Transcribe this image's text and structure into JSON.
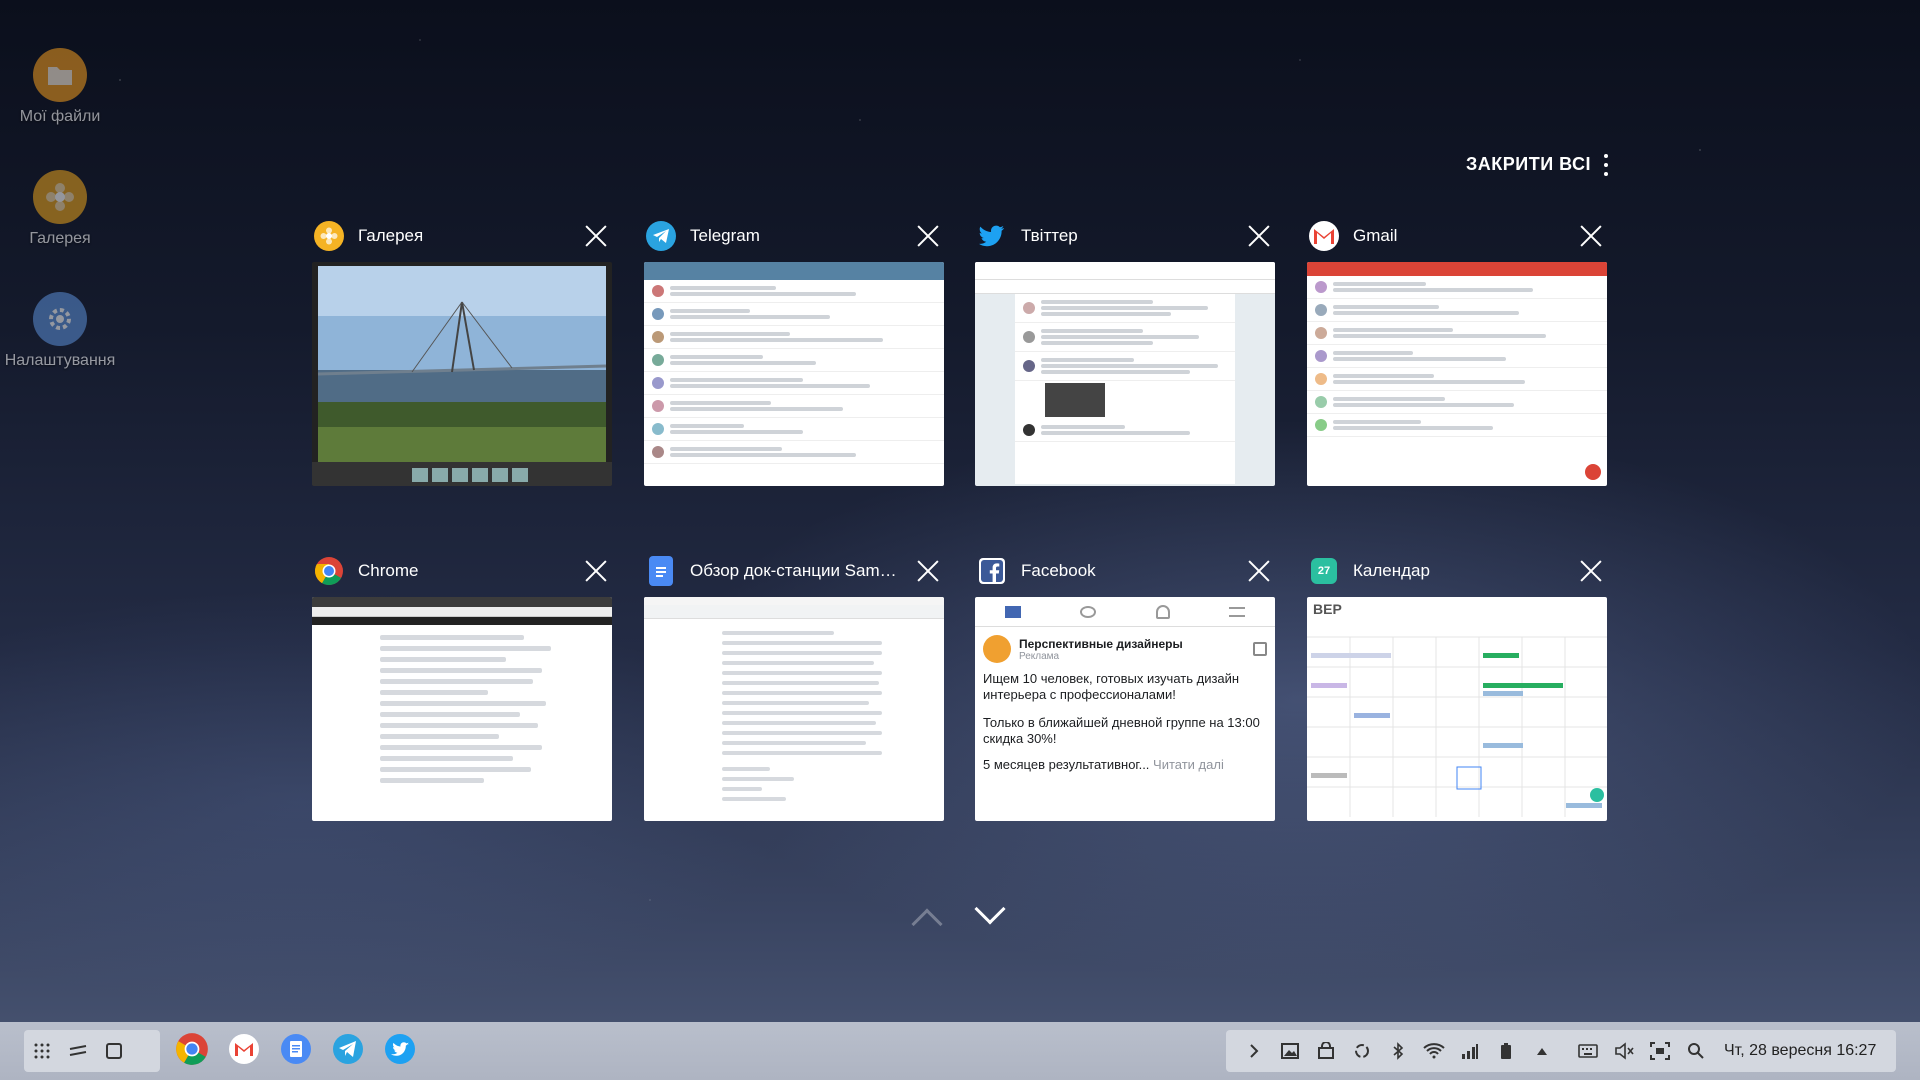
{
  "desktop": {
    "icons": [
      {
        "label": "Мої файли",
        "icon": "folder-icon"
      },
      {
        "label": "Галерея",
        "icon": "flower-icon"
      },
      {
        "label": "Налаштування",
        "icon": "gear-icon"
      }
    ]
  },
  "recents": {
    "close_all_label": "ЗАКРИТИ ВСІ",
    "cards": [
      {
        "title": "Галерея",
        "icon": "gallery-icon",
        "color": "#f5b324"
      },
      {
        "title": "Telegram",
        "icon": "telegram-icon",
        "color": "#2aa3e0"
      },
      {
        "title": "Твіттер",
        "icon": "twitter-icon",
        "color": "#1da1f2"
      },
      {
        "title": "Gmail",
        "icon": "gmail-icon",
        "color": "#ea4335"
      },
      {
        "title": "Chrome",
        "icon": "chrome-icon",
        "color": "#4285f4"
      },
      {
        "title": "Обзор док-станции Samsung...",
        "icon": "docs-icon",
        "color": "#4a8af4"
      },
      {
        "title": "Facebook",
        "icon": "facebook-icon",
        "color": "#3b5998"
      },
      {
        "title": "Календар",
        "icon": "calendar-icon",
        "color": "#2bbfa0"
      }
    ],
    "facebook_preview": {
      "page": "Перспективные дизайнеры",
      "sub": "Реклама",
      "line1": "Ищем 10 человек, готовых изучать дизайн интерьера с профессионалами!",
      "line2": "Только в ближайшей дневной группе на 13:00 скидка 30%!",
      "line3": "5 месяцев результативног...",
      "more": "Читати далі"
    },
    "calendar_preview": {
      "month": "ВЕР"
    },
    "gallery_icon_badge": "27"
  },
  "taskbar": {
    "clock": "Чт, 28 вересня 16:27",
    "apps": [
      "chrome-icon",
      "gmail-icon",
      "docs-icon",
      "telegram-icon",
      "twitter-icon"
    ]
  }
}
